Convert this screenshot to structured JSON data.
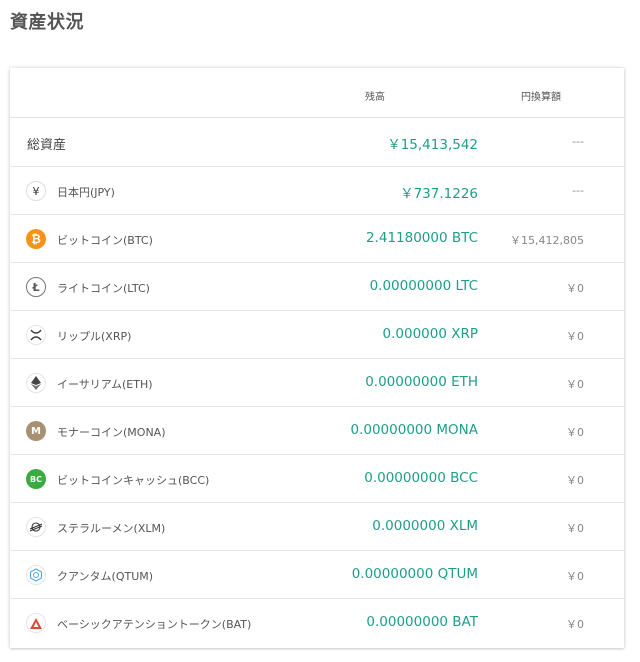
{
  "page_title": "資産状況",
  "header": {
    "balance_label": "残高",
    "jpy_label": "円換算額"
  },
  "total": {
    "label": "総資産",
    "balance": "￥15,413,542",
    "jpy": "---"
  },
  "assets": [
    {
      "icon": "yen-icon",
      "name": "日本円(JPY)",
      "balance": "￥737.1226",
      "jpy": "---"
    },
    {
      "icon": "bitcoin-icon",
      "name": "ビットコイン(BTC)",
      "balance": "2.41180000  BTC",
      "jpy": "￥15,412,805"
    },
    {
      "icon": "litecoin-icon",
      "name": "ライトコイン(LTC)",
      "balance": "0.00000000  LTC",
      "jpy": "￥0"
    },
    {
      "icon": "ripple-icon",
      "name": "リップル(XRP)",
      "balance": "0.000000  XRP",
      "jpy": "￥0"
    },
    {
      "icon": "ethereum-icon",
      "name": "イーサリアム(ETH)",
      "balance": "0.00000000  ETH",
      "jpy": "￥0"
    },
    {
      "icon": "monacoin-icon",
      "name": "モナーコイン(MONA)",
      "balance": "0.00000000  MONA",
      "jpy": "￥0"
    },
    {
      "icon": "bitcoin-cash-icon",
      "name": "ビットコインキャッシュ(BCC)",
      "balance": "0.00000000  BCC",
      "jpy": "￥0"
    },
    {
      "icon": "stellar-icon",
      "name": "ステラルーメン(XLM)",
      "balance": "0.0000000  XLM",
      "jpy": "￥0"
    },
    {
      "icon": "qtum-icon",
      "name": "クアンタム(QTUM)",
      "balance": "0.00000000  QTUM",
      "jpy": "￥0"
    },
    {
      "icon": "bat-icon",
      "name": "ベーシックアテンショントークン(BAT)",
      "balance": "0.00000000  BAT",
      "jpy": "￥0"
    }
  ],
  "colors": {
    "accent": "#1f9d8a",
    "btc": "#f7931a",
    "bcc": "#3aab3e",
    "mona": "#a89072",
    "bat": "#e3472f"
  }
}
